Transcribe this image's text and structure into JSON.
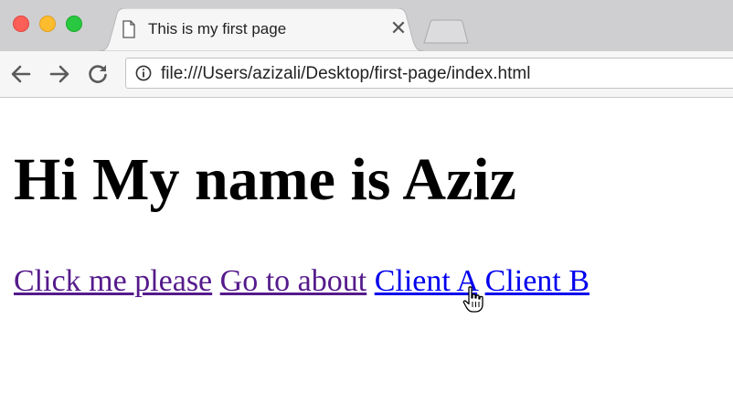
{
  "browser": {
    "tab": {
      "title": "This is my first page",
      "close_glyph": "✕",
      "icon": "page-icon"
    },
    "toolbar": {
      "back_icon": "arrow-left-icon",
      "forward_icon": "arrow-right-icon",
      "reload_icon": "reload-icon",
      "url": "file:///Users/azizali/Desktop/first-page/index.html",
      "info_icon": "info-icon"
    }
  },
  "page": {
    "heading": "Hi My name is Aziz",
    "links": [
      {
        "label": "Click me please",
        "visited": true
      },
      {
        "label": "Go to about",
        "visited": true
      },
      {
        "label": "Client A",
        "visited": false
      },
      {
        "label": "Client B",
        "visited": false
      }
    ]
  },
  "colors": {
    "visited_link": "#551a8b",
    "unvisited_link": "#0000ee",
    "tabstrip": "#cfcfd1"
  }
}
